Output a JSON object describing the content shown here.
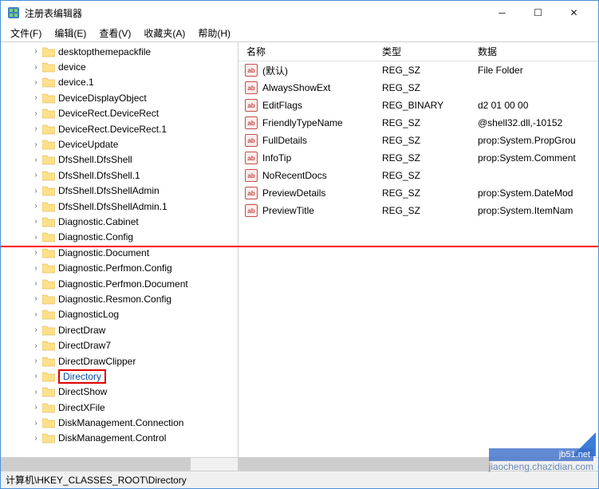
{
  "window": {
    "title": "注册表编辑器"
  },
  "menu": {
    "file": "文件(F)",
    "edit": "编辑(E)",
    "view": "查看(V)",
    "favorites": "收藏夹(A)",
    "help": "帮助(H)"
  },
  "tree": {
    "indent_base": 38,
    "items": [
      {
        "label": "desktopthemepackfile",
        "depth": 0
      },
      {
        "label": "device",
        "depth": 0
      },
      {
        "label": "device.1",
        "depth": 0
      },
      {
        "label": "DeviceDisplayObject",
        "depth": 0
      },
      {
        "label": "DeviceRect.DeviceRect",
        "depth": 0
      },
      {
        "label": "DeviceRect.DeviceRect.1",
        "depth": 0
      },
      {
        "label": "DeviceUpdate",
        "depth": 0
      },
      {
        "label": "DfsShell.DfsShell",
        "depth": 0
      },
      {
        "label": "DfsShell.DfsShell.1",
        "depth": 0
      },
      {
        "label": "DfsShell.DfsShellAdmin",
        "depth": 0
      },
      {
        "label": "DfsShell.DfsShellAdmin.1",
        "depth": 0
      },
      {
        "label": "Diagnostic.Cabinet",
        "depth": 0
      },
      {
        "label": "Diagnostic.Config",
        "depth": 0
      },
      {
        "label": "Diagnostic.Document",
        "depth": 0
      },
      {
        "label": "Diagnostic.Perfmon.Config",
        "depth": 0
      },
      {
        "label": "Diagnostic.Perfmon.Document",
        "depth": 0
      },
      {
        "label": "Diagnostic.Resmon.Config",
        "depth": 0
      },
      {
        "label": "DiagnosticLog",
        "depth": 0
      },
      {
        "label": "DirectDraw",
        "depth": 0
      },
      {
        "label": "DirectDraw7",
        "depth": 0
      },
      {
        "label": "DirectDrawClipper",
        "depth": 0
      },
      {
        "label": "Directory",
        "depth": 0,
        "highlight": true
      },
      {
        "label": "DirectShow",
        "depth": 0
      },
      {
        "label": "DirectXFile",
        "depth": 0
      },
      {
        "label": "DiskManagement.Connection",
        "depth": 0
      },
      {
        "label": "DiskManagement.Control",
        "depth": 0
      }
    ]
  },
  "list": {
    "headers": {
      "name": "名称",
      "type": "类型",
      "data": "数据"
    },
    "rows": [
      {
        "name": "(默认)",
        "type": "REG_SZ",
        "data": "File Folder"
      },
      {
        "name": "AlwaysShowExt",
        "type": "REG_SZ",
        "data": ""
      },
      {
        "name": "EditFlags",
        "type": "REG_BINARY",
        "data": "d2 01 00 00"
      },
      {
        "name": "FriendlyTypeName",
        "type": "REG_SZ",
        "data": "@shell32.dll,-10152"
      },
      {
        "name": "FullDetails",
        "type": "REG_SZ",
        "data": "prop:System.PropGrou"
      },
      {
        "name": "InfoTip",
        "type": "REG_SZ",
        "data": "prop:System.Comment"
      },
      {
        "name": "NoRecentDocs",
        "type": "REG_SZ",
        "data": ""
      },
      {
        "name": "PreviewDetails",
        "type": "REG_SZ",
        "data": "prop:System.DateMod"
      },
      {
        "name": "PreviewTitle",
        "type": "REG_SZ",
        "data": "prop:System.ItemNam"
      }
    ]
  },
  "statusbar": {
    "path": "计算机\\HKEY_CLASSES_ROOT\\Directory"
  },
  "watermark": {
    "line1": "jb51.net",
    "line2": "jiaocheng.chazidian.com"
  }
}
